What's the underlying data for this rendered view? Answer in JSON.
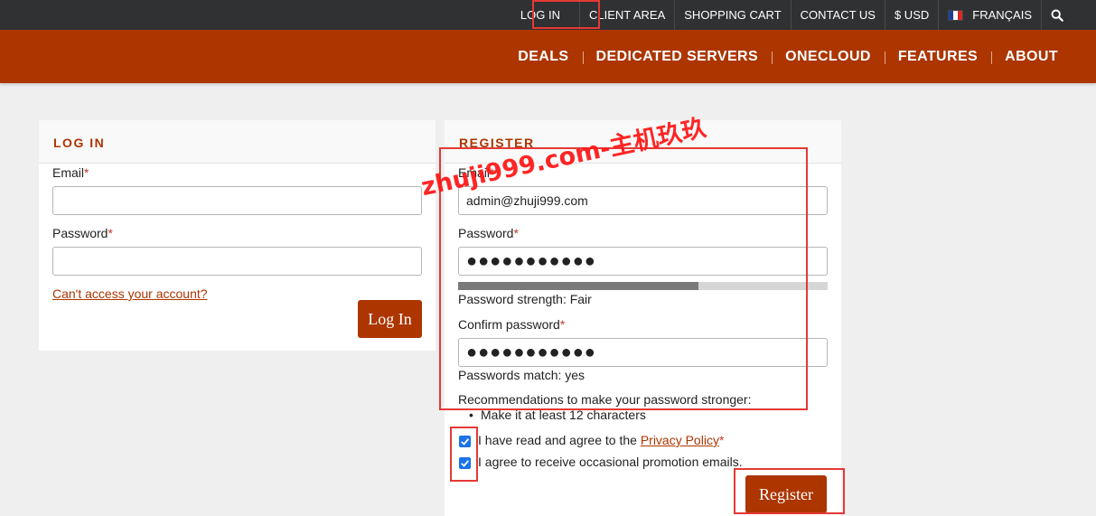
{
  "topbar": {
    "login": "LOG IN",
    "client_area": "CLIENT AREA",
    "shopping_cart": "SHOPPING CART",
    "contact_us": "CONTACT US",
    "currency": "$ USD",
    "language": "FRANÇAIS",
    "search_icon": "search-icon"
  },
  "mainnav": {
    "items": [
      "DEALS",
      "DEDICATED SERVERS",
      "ONECLOUD",
      "FEATURES",
      "ABOUT"
    ]
  },
  "login_panel": {
    "title": "LOG IN",
    "email_label": "Email",
    "password_label": "Password",
    "required_mark": "*",
    "email_value": "",
    "password_value": "",
    "forgot_link": "Can't access your account?",
    "submit_label": "Log In"
  },
  "register_panel": {
    "title": "REGISTER",
    "email_label": "Email",
    "email_value": "admin@zhuji999.com",
    "password_label": "Password",
    "password_masked": "●●●●●●●●●●●",
    "strength_text": "Password strength: Fair",
    "strength_level": 0.65,
    "confirm_label": "Confirm password",
    "confirm_masked": "●●●●●●●●●●●",
    "match_text": "Passwords match: yes",
    "recommendations_title": "Recommendations to make your password stronger:",
    "recommendations": [
      "Make it at least 12 characters"
    ],
    "agree_prefix": "I have read and agree to the ",
    "privacy_link": "Privacy Policy",
    "agree_checked": true,
    "promo_text": "I agree to receive occasional promotion emails.",
    "promo_checked": true,
    "submit_label": "Register"
  },
  "watermark": "zhuji999.com-主机玖玖",
  "colors": {
    "brand": "#ac3500",
    "topbar": "#2f3133",
    "annotation": "#e53935",
    "checkbox": "#1a73e8"
  }
}
